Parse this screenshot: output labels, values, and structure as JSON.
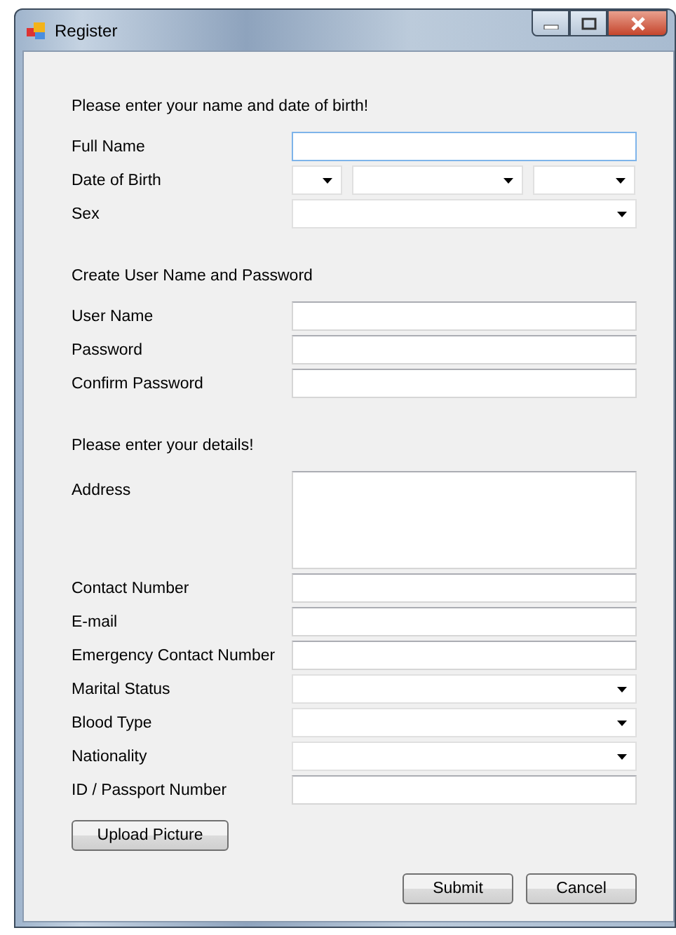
{
  "window": {
    "title": "Register"
  },
  "sections": [
    {
      "heading": "Please enter your name and date of birth!",
      "fields": [
        {
          "label": "Full Name",
          "kind": "text",
          "focused": true
        },
        {
          "label": "Date of Birth",
          "kind": "date",
          "focused": false
        },
        {
          "label": "Sex",
          "kind": "combo",
          "focused": false
        }
      ]
    },
    {
      "heading": "Create User Name and Password",
      "fields": [
        {
          "label": "User Name",
          "kind": "text",
          "focused": false
        },
        {
          "label": "Password",
          "kind": "text",
          "focused": false
        },
        {
          "label": "Confirm Password",
          "kind": "text",
          "focused": false
        }
      ]
    },
    {
      "heading": "Please enter your details!",
      "fields": [
        {
          "label": "Address",
          "kind": "multiline",
          "focused": false
        },
        {
          "label": "Contact Number",
          "kind": "text",
          "focused": false
        },
        {
          "label": "E-mail",
          "kind": "text",
          "focused": false
        },
        {
          "label": "Emergency Contact Number",
          "kind": "text",
          "focused": false
        },
        {
          "label": "Marital Status",
          "kind": "combo",
          "focused": false
        },
        {
          "label": "Blood Type",
          "kind": "combo",
          "focused": false
        },
        {
          "label": "Nationality",
          "kind": "combo",
          "focused": false
        },
        {
          "label": "ID / Passport Number",
          "kind": "text",
          "focused": false
        }
      ]
    }
  ],
  "upload_button": "Upload Picture",
  "buttons": [
    "Submit",
    "Cancel"
  ]
}
